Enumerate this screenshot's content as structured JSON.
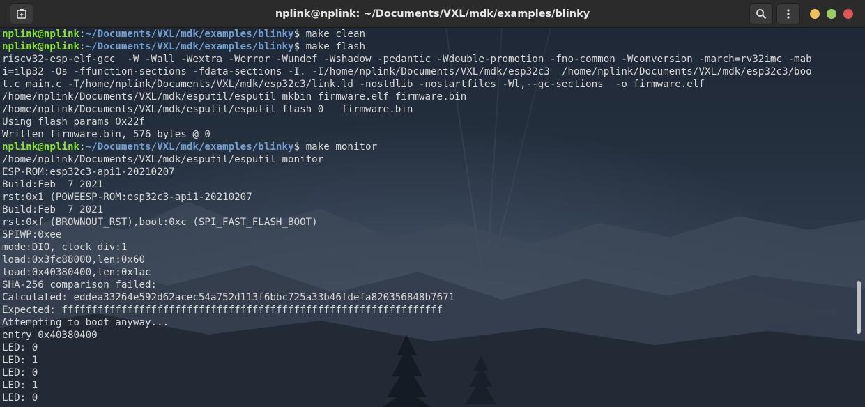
{
  "window": {
    "title": "nplink@nplink: ~/Documents/VXL/mdk/examples/blinky"
  },
  "prompt": {
    "user_host": "nplink@nplink",
    "path": "~/Documents/VXL/mdk/examples/blinky"
  },
  "colors": {
    "prompt_user": "#8ae234",
    "prompt_path": "#729fcf",
    "text": "#d8d8d8",
    "minimize": "#f0c060",
    "maximize": "#9ccc65",
    "close": "#e0545a"
  },
  "icons": {
    "new_tab": "new-tab-icon",
    "search": "search-icon",
    "menu": "kebab-menu-icon"
  },
  "lines": [
    {
      "prompt": true,
      "text": "$ make clean"
    },
    {
      "prompt": true,
      "text": "$ make flash"
    },
    {
      "text": "riscv32-esp-elf-gcc  -W -Wall -Wextra -Werror -Wundef -Wshadow -pedantic -Wdouble-promotion -fno-common -Wconversion -march=rv32imc -mab"
    },
    {
      "text": "i=ilp32 -Os -ffunction-sections -fdata-sections -I. -I/home/nplink/Documents/VXL/mdk/esp32c3  /home/nplink/Documents/VXL/mdk/esp32c3/boo"
    },
    {
      "text": "t.c main.c -T/home/nplink/Documents/VXL/mdk/esp32c3/link.ld -nostdlib -nostartfiles -Wl,--gc-sections  -o firmware.elf"
    },
    {
      "text": "/home/nplink/Documents/VXL/mdk/esputil/esputil mkbin firmware.elf firmware.bin"
    },
    {
      "text": "/home/nplink/Documents/VXL/mdk/esputil/esputil flash 0   firmware.bin"
    },
    {
      "text": "Using flash params 0x22f"
    },
    {
      "text": "Written firmware.bin, 576 bytes @ 0"
    },
    {
      "prompt": true,
      "text": "$ make monitor"
    },
    {
      "text": "/home/nplink/Documents/VXL/mdk/esputil/esputil monitor"
    },
    {
      "text": "ESP-ROM:esp32c3-api1-20210207"
    },
    {
      "text": "Build:Feb  7 2021"
    },
    {
      "text": "rst:0x1 (POWEESP-ROM:esp32c3-api1-20210207"
    },
    {
      "text": "Build:Feb  7 2021"
    },
    {
      "text": "rst:0xf (BROWNOUT_RST),boot:0xc (SPI_FAST_FLASH_BOOT)"
    },
    {
      "text": "SPIWP:0xee"
    },
    {
      "text": "mode:DIO, clock div:1"
    },
    {
      "text": "load:0x3fc88000,len:0x60"
    },
    {
      "text": "load:0x40380400,len:0x1ac"
    },
    {
      "text": "SHA-256 comparison failed:"
    },
    {
      "text": "Calculated: eddea33264e592d62acec54a752d113f6bbc725a33b46fdefa820356848b7671"
    },
    {
      "text": "Expected: ffffffffffffffffffffffffffffffffffffffffffffffffffffffffffffffff"
    },
    {
      "text": "Attempting to boot anyway..."
    },
    {
      "text": "entry 0x40380400"
    },
    {
      "text": "LED: 0"
    },
    {
      "text": "LED: 1"
    },
    {
      "text": "LED: 0"
    },
    {
      "text": "LED: 1"
    },
    {
      "text": "LED: 0"
    }
  ]
}
